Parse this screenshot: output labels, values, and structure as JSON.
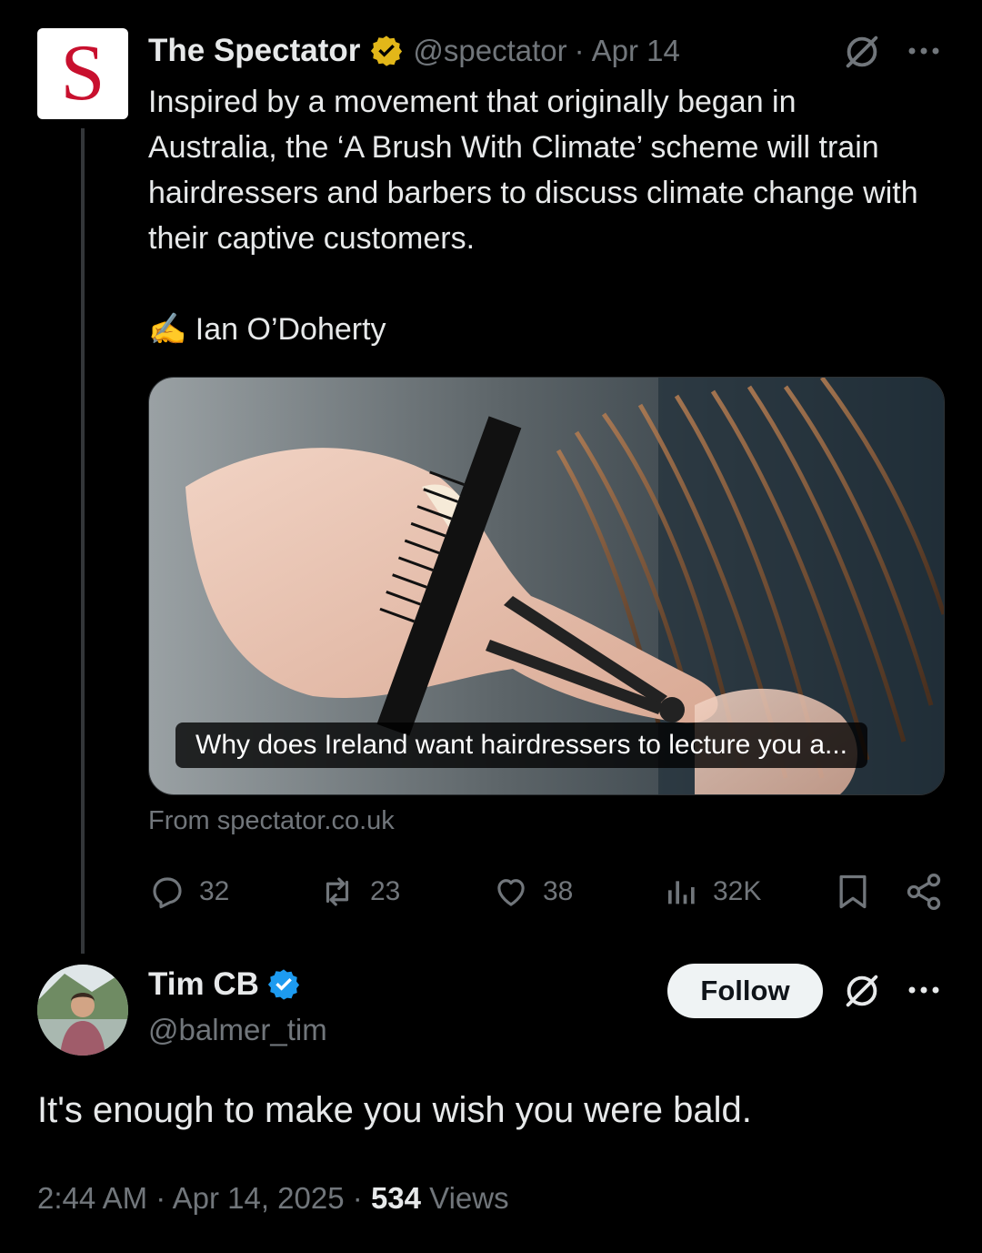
{
  "tweet": {
    "logo_letter": "S",
    "author_name": "The Spectator",
    "author_handle": "@spectator",
    "separator": "·",
    "date": "Apr 14",
    "text": "Inspired by a movement that originally began in Australia, the ‘A Brush With Climate’ scheme will train hairdressers and barbers to discuss climate change with their captive customers.\n\n✍️ Ian O’Doherty",
    "card_title": "Why does Ireland want hairdressers to lecture you a...",
    "card_source": "From spectator.co.uk",
    "stats": {
      "replies": "32",
      "reposts": "23",
      "likes": "38",
      "views": "32K"
    }
  },
  "reply": {
    "author_name": "Tim CB",
    "author_handle": "@balmer_tim",
    "follow_label": "Follow",
    "text": "It's enough to make you wish you were bald.",
    "time": "2:44 AM",
    "separator": "·",
    "date": "Apr 14, 2025",
    "views_count": "534",
    "views_label": "Views"
  },
  "colors": {
    "background": "#000000",
    "text": "#e7e9ea",
    "muted": "#71767b",
    "verified_gold": "#e2b719",
    "verified_blue": "#1d9bf0",
    "brand_red": "#c8102e"
  },
  "icons": [
    "verified-gold-icon",
    "grok-icon",
    "more-icon",
    "reply-icon",
    "repost-icon",
    "like-icon",
    "views-icon",
    "bookmark-icon",
    "share-icon",
    "verified-blue-icon"
  ]
}
